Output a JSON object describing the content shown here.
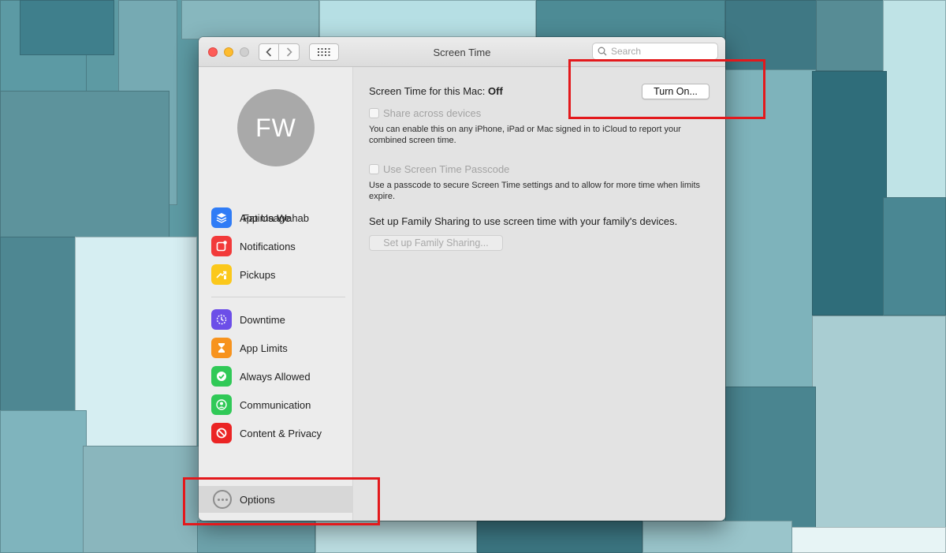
{
  "window": {
    "title": "Screen Time",
    "search": {
      "placeholder": "Search"
    }
  },
  "sidebar": {
    "avatar_initials": "FW",
    "user_name": "Fatima Wahab",
    "group1": [
      {
        "label": "App Usage",
        "icon": "layers-icon",
        "color": "#2f7cf6"
      },
      {
        "label": "Notifications",
        "icon": "notification-icon",
        "color": "#f23a3a"
      },
      {
        "label": "Pickups",
        "icon": "pickup-arrow-icon",
        "color": "#fbc81b"
      }
    ],
    "group2": [
      {
        "label": "Downtime",
        "icon": "moon-clock-icon",
        "color": "#6c4ee8"
      },
      {
        "label": "App Limits",
        "icon": "hourglass-icon",
        "color": "#f7931e"
      },
      {
        "label": "Always Allowed",
        "icon": "checkmark-badge-icon",
        "color": "#30c957"
      },
      {
        "label": "Communication",
        "icon": "person-circle-icon",
        "color": "#30c957"
      },
      {
        "label": "Content & Privacy",
        "icon": "no-entry-icon",
        "color": "#eb2424"
      }
    ],
    "options_label": "Options"
  },
  "main": {
    "status_prefix": "Screen Time for this Mac:",
    "status_value": "Off",
    "turn_on_label": "Turn On...",
    "share_label": "Share across devices",
    "share_desc": "You can enable this on any iPhone, iPad or Mac signed in to iCloud to report your combined screen time.",
    "passcode_label": "Use Screen Time Passcode",
    "passcode_desc": "Use a passcode to secure Screen Time settings and to allow for more time when limits expire.",
    "family_text": "Set up Family Sharing to use screen time with your family's devices.",
    "family_button": "Set up Family Sharing..."
  }
}
